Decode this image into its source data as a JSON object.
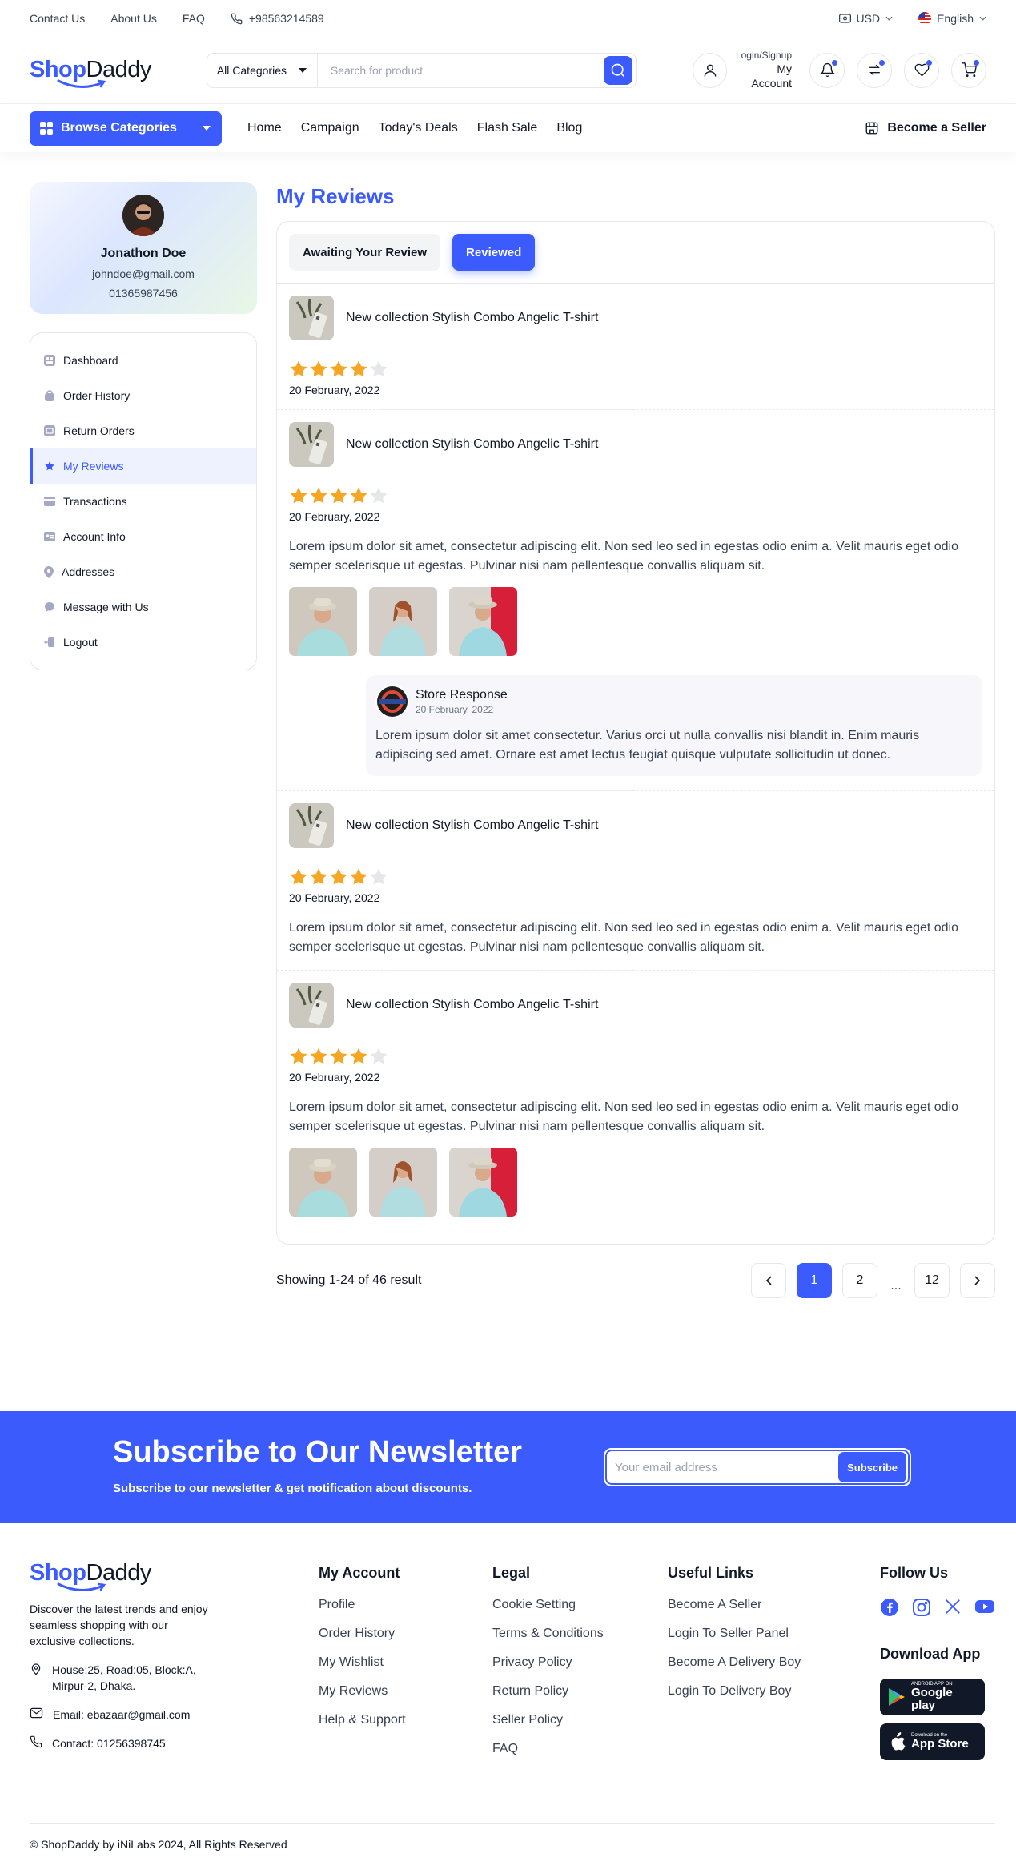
{
  "topbar": {
    "links": [
      "Contact Us",
      "About Us",
      "FAQ"
    ],
    "phone": "+98563214589",
    "currency": "USD",
    "language": "English"
  },
  "header": {
    "logo_part1": "Shop",
    "logo_part2": "Daddy",
    "category_select": "All Categories",
    "search_placeholder": "Search for product",
    "account_line1": "Login/Signup",
    "account_line2": "My Account"
  },
  "nav": {
    "browse_label": "Browse Categories",
    "links": [
      "Home",
      "Campaign",
      "Today's Deals",
      "Flash Sale",
      "Blog"
    ],
    "seller_label": "Become a Seller"
  },
  "profile": {
    "name": "Jonathon Doe",
    "email": "johndoe@gmail.com",
    "phone": "01365987456"
  },
  "sidebar": {
    "items": [
      {
        "label": "Dashboard",
        "icon": "dashboard-icon"
      },
      {
        "label": "Order History",
        "icon": "bag-icon"
      },
      {
        "label": "Return Orders",
        "icon": "return-icon"
      },
      {
        "label": "My Reviews",
        "icon": "star-review-icon"
      },
      {
        "label": "Transactions",
        "icon": "card-icon"
      },
      {
        "label": "Account Info",
        "icon": "id-card-icon"
      },
      {
        "label": "Addresses",
        "icon": "pin-icon"
      },
      {
        "label": "Message with Us",
        "icon": "chat-icon"
      },
      {
        "label": "Logout",
        "icon": "logout-icon"
      }
    ],
    "active_index": 3
  },
  "main": {
    "title": "My Reviews",
    "tabs": [
      "Awaiting Your Review",
      "Reviewed"
    ],
    "active_tab": 1,
    "reviews": [
      {
        "product": "New collection Stylish Combo Angelic T-shirt",
        "rating": 4,
        "date": "20 February, 2022"
      },
      {
        "product": "New collection Stylish Combo Angelic T-shirt",
        "rating": 4,
        "date": "20 February, 2022",
        "text": "Lorem ipsum dolor sit amet, consectetur adipiscing elit. Non sed leo sed in egestas odio enim a. Velit mauris eget odio semper scelerisque ut egestas. Pulvinar nisi nam pellentesque convallis aliquam sit.",
        "response": {
          "name": "Store Response",
          "date": "20 February, 2022",
          "text": "Lorem ipsum dolor sit amet consectetur. Varius orci ut nulla convallis nisi blandit in. Enim mauris adipiscing sed amet. Ornare est amet lectus feugiat quisque vulputate sollicitudin ut donec."
        }
      },
      {
        "product": "New collection Stylish Combo Angelic T-shirt",
        "rating": 4,
        "date": "20 February, 2022",
        "text": "Lorem ipsum dolor sit amet, consectetur adipiscing elit. Non sed leo sed in egestas odio enim a. Velit mauris eget odio semper scelerisque ut egestas. Pulvinar nisi nam pellentesque convallis aliquam sit."
      },
      {
        "product": "New collection Stylish Combo Angelic T-shirt",
        "rating": 4,
        "date": "20 February, 2022",
        "text": "Lorem ipsum dolor sit amet, consectetur adipiscing elit. Non sed leo sed in egestas odio enim a. Velit mauris eget odio semper scelerisque ut egestas. Pulvinar nisi nam pellentesque convallis aliquam sit."
      }
    ]
  },
  "pagination": {
    "info": "Showing 1-24 of 46 result",
    "pages": [
      "1",
      "2",
      "...",
      "12"
    ],
    "active_page": "1"
  },
  "newsletter": {
    "title": "Subscribe to Our Newsletter",
    "subtitle": "Subscribe to our newsletter & get notification about discounts.",
    "placeholder": "Your email address",
    "button": "Subscribe"
  },
  "footer": {
    "description": "Discover the latest trends and enjoy seamless shopping with our exclusive collections.",
    "address": "House:25, Road:05, Block:A, Mirpur-2, Dhaka.",
    "email": "Email: ebazaar@gmail.com",
    "contact": "Contact: 01256398745",
    "my_account": {
      "title": "My Account",
      "links": [
        "Profile",
        "Order History",
        "My Wishlist",
        "My Reviews",
        "Help & Support"
      ]
    },
    "legal": {
      "title": "Legal",
      "links": [
        "Cookie Setting",
        "Terms & Conditions",
        "Privacy Policy",
        "Return Policy",
        "Seller Policy",
        "FAQ"
      ]
    },
    "useful": {
      "title": "Useful Links",
      "links": [
        "Become A Seller",
        "Login To Seller Panel",
        "Become A Delivery Boy",
        "Login To Delivery Boy"
      ]
    },
    "follow_title": "Follow Us",
    "download_title": "Download App",
    "google_small": "ANDROID APP ON",
    "google_big": "Google play",
    "apple_small": "Download on the",
    "apple_big": "App Store",
    "copyright": "© ShopDaddy by iNiLabs 2024, All Rights Reserved"
  },
  "colors": {
    "accent": "#3b5bfd",
    "star": "#f5a623",
    "star_empty": "#e5e7eb"
  }
}
